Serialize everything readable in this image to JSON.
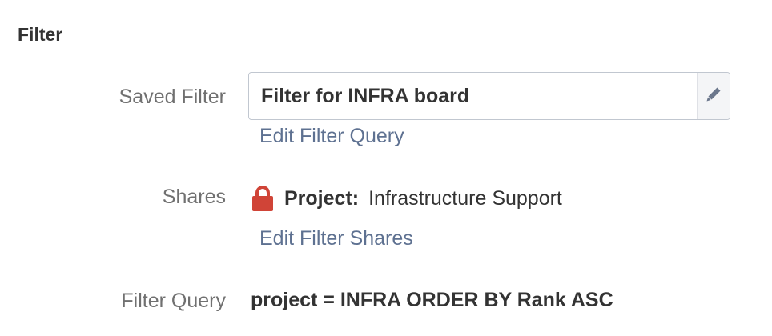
{
  "section": {
    "title": "Filter"
  },
  "saved_filter": {
    "label": "Saved Filter",
    "value": "Filter for INFRA board",
    "edit_query_link": "Edit Filter Query"
  },
  "shares": {
    "label": "Shares",
    "type": "Project:",
    "value": "Infrastructure Support",
    "edit_shares_link": "Edit Filter Shares",
    "icon": "lock-icon",
    "icon_color": "#d04437"
  },
  "filter_query": {
    "label": "Filter Query",
    "value": "project = INFRA ORDER BY Rank ASC"
  },
  "colors": {
    "link": "#5e7191",
    "label": "#707070",
    "text": "#333333"
  }
}
